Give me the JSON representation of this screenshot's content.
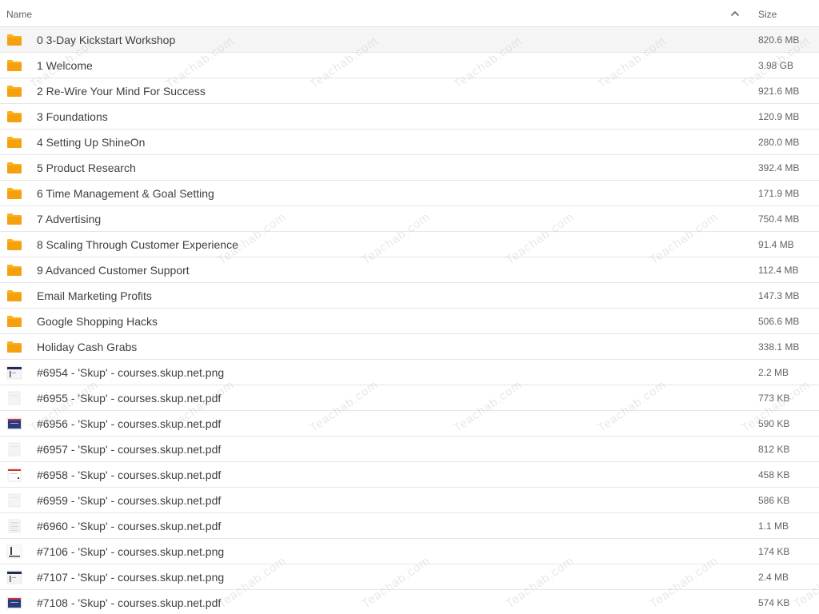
{
  "header": {
    "name_label": "Name",
    "size_label": "Size",
    "sort_icon": "chevron-up-icon"
  },
  "files": [
    {
      "name": "0 3-Day Kickstart Workshop",
      "size": "820.6 MB",
      "type": "folder"
    },
    {
      "name": "1 Welcome",
      "size": "3.98 GB",
      "type": "folder"
    },
    {
      "name": "2 Re-Wire Your Mind For Success",
      "size": "921.6 MB",
      "type": "folder"
    },
    {
      "name": "3 Foundations",
      "size": "120.9 MB",
      "type": "folder"
    },
    {
      "name": "4 Setting Up ShineOn",
      "size": "280.0 MB",
      "type": "folder"
    },
    {
      "name": "5 Product Research",
      "size": "392.4 MB",
      "type": "folder"
    },
    {
      "name": "6 Time Management & Goal Setting",
      "size": "171.9 MB",
      "type": "folder"
    },
    {
      "name": "7 Advertising",
      "size": "750.4 MB",
      "type": "folder"
    },
    {
      "name": "8 Scaling Through Customer Experience",
      "size": "91.4 MB",
      "type": "folder"
    },
    {
      "name": "9 Advanced Customer Support",
      "size": "112.4 MB",
      "type": "folder"
    },
    {
      "name": "Email Marketing Profits",
      "size": "147.3 MB",
      "type": "folder"
    },
    {
      "name": "Google Shopping Hacks",
      "size": "506.6 MB",
      "type": "folder"
    },
    {
      "name": "Holiday Cash Grabs",
      "size": "338.1 MB",
      "type": "folder"
    },
    {
      "name": "#6954 - 'Skup' - courses.skup.net.png",
      "size": "2.2 MB",
      "type": "image-thumb-a"
    },
    {
      "name": "#6955 - 'Skup' - courses.skup.net.pdf",
      "size": "773 KB",
      "type": "doc-thumb-plain"
    },
    {
      "name": "#6956 - 'Skup' - courses.skup.net.pdf",
      "size": "590 KB",
      "type": "doc-thumb-blue"
    },
    {
      "name": "#6957 - 'Skup' - courses.skup.net.pdf",
      "size": "812 KB",
      "type": "doc-thumb-plain"
    },
    {
      "name": "#6958 - 'Skup' - courses.skup.net.pdf",
      "size": "458 KB",
      "type": "doc-thumb-red"
    },
    {
      "name": "#6959 - 'Skup' - courses.skup.net.pdf",
      "size": "586 KB",
      "type": "doc-thumb-plain"
    },
    {
      "name": "#6960 - 'Skup' - courses.skup.net.pdf",
      "size": "1.1 MB",
      "type": "doc-thumb-lines"
    },
    {
      "name": "#7106 - 'Skup' - courses.skup.net.png",
      "size": "174 KB",
      "type": "image-thumb-b"
    },
    {
      "name": "#7107 - 'Skup' - courses.skup.net.png",
      "size": "2.4 MB",
      "type": "image-thumb-a"
    },
    {
      "name": "#7108 - 'Skup' - courses.skup.net.pdf",
      "size": "574 KB",
      "type": "doc-thumb-blue"
    }
  ],
  "watermark": {
    "text": "Teachab.com"
  },
  "colors": {
    "folder": "#fbb21a",
    "folder_dark": "#f5a00f",
    "highlight_row": "#f5f5f5",
    "text": "#3c4043",
    "muted": "#5f6368"
  }
}
